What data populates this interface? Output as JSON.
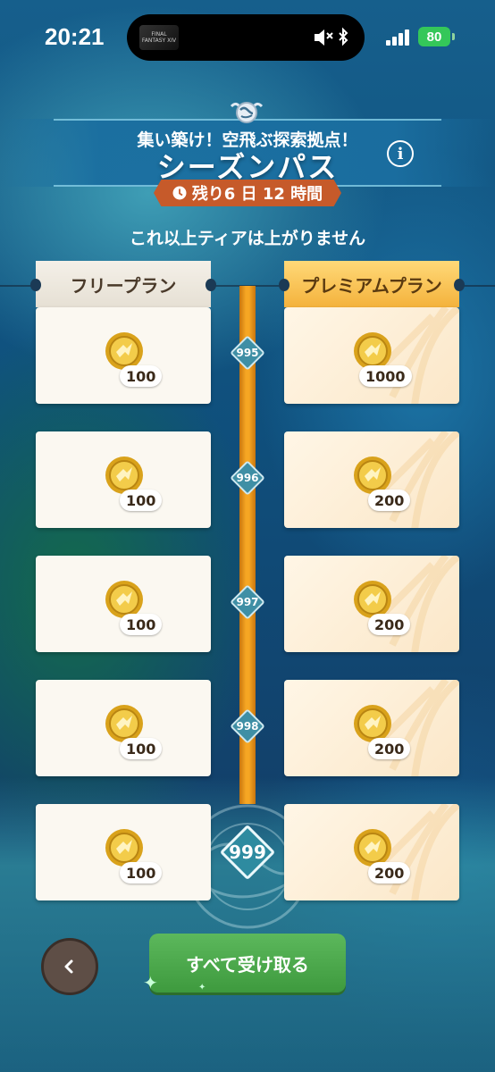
{
  "status_bar": {
    "time": "20:21",
    "battery": "80",
    "island_label": "FINAL FANTASY XIV"
  },
  "header": {
    "subtitle": "集い築け！空飛ぶ探索拠点！",
    "title": "シーズンパス",
    "timer": "残り6 日 12 時間",
    "info_label": "i"
  },
  "notice": "これ以上ティアは上がりません",
  "plans": {
    "free_label": "フリープラン",
    "premium_label": "プレミアムプラン"
  },
  "tiers": [
    {
      "tier": "995",
      "free_amount": "100",
      "premium_amount": "1000"
    },
    {
      "tier": "996",
      "free_amount": "100",
      "premium_amount": "200"
    },
    {
      "tier": "997",
      "free_amount": "100",
      "premium_amount": "200"
    },
    {
      "tier": "998",
      "free_amount": "100",
      "premium_amount": "200"
    },
    {
      "tier": "999",
      "free_amount": "100",
      "premium_amount": "200"
    }
  ],
  "footer": {
    "claim_all_label": "すべて受け取る"
  },
  "colors": {
    "track": "#f6a623",
    "timer_bg": "#c65a2a",
    "claim_button": "#4caf50",
    "premium_label": "#f4b23c"
  }
}
